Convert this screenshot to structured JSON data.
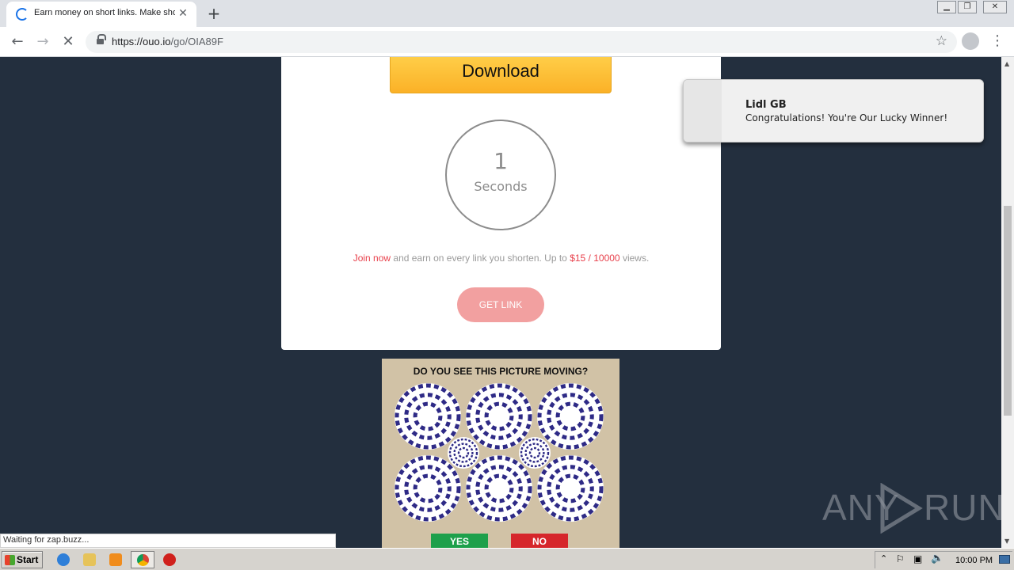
{
  "browser": {
    "tab_title": "Earn money on short links. Make sho",
    "tab_close": "✕",
    "new_tab": "+",
    "url_host": "https://ouo.io",
    "url_path": "/go/OIA89F",
    "status_text": "Waiting for zap.buzz..."
  },
  "page": {
    "download_label": "Download",
    "countdown_value": "1",
    "countdown_unit": "Seconds",
    "promo_join": "Join now",
    "promo_mid": " and earn on every link you shorten. Up to ",
    "promo_rate": "$15 / 10000",
    "promo_end": " views.",
    "get_link_label": "GET LINK"
  },
  "ad": {
    "headline": "DO YOU SEE THIS PICTURE MOVING?",
    "yes_label": "YES",
    "no_label": "NO"
  },
  "notification": {
    "title": "Lidl GB",
    "message": "Congratulations! You're Our Lucky Winner!"
  },
  "watermark": {
    "left": "ANY",
    "right": "RUN"
  },
  "taskbar": {
    "start_label": "Start",
    "clock": "10:00 PM"
  },
  "colors": {
    "page_background": "#232f3e",
    "promo_red": "#e8414c",
    "get_link_pink": "#f2a0a0",
    "download_yellow": "#fbb127"
  }
}
